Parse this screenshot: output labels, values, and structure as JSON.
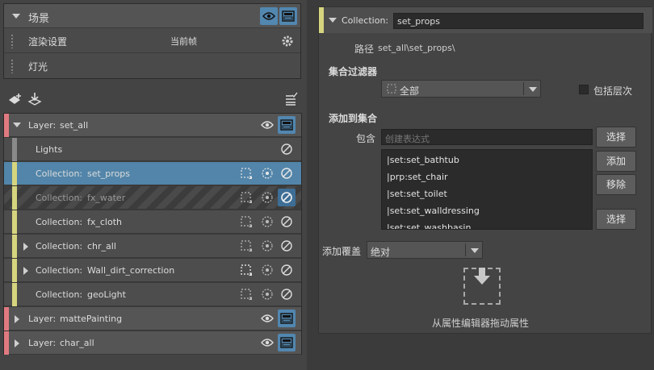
{
  "scene": {
    "title": "场景",
    "rows": [
      {
        "label": "渲染设置",
        "value": "当前帧"
      },
      {
        "label": "灯光"
      }
    ]
  },
  "list": [
    {
      "kind": "layer",
      "prefix": "Layer:",
      "name": "set_all",
      "expanded": true,
      "color": "#e07a80"
    },
    {
      "kind": "collection",
      "prefix": "",
      "name": "Lights",
      "color": "#8a8a8a",
      "state": "normal"
    },
    {
      "kind": "collection",
      "prefix": "Collection:",
      "name": "set_props",
      "color": "#d6d57f",
      "state": "selected"
    },
    {
      "kind": "collection",
      "prefix": "Collection:",
      "name": "fx_water",
      "color": "#d6d57f",
      "state": "disabled"
    },
    {
      "kind": "collection",
      "prefix": "Collection:",
      "name": "fx_cloth",
      "color": "#d6d57f",
      "state": "normal"
    },
    {
      "kind": "collection",
      "prefix": "Collection:",
      "name": "chr_all",
      "color": "#d6d57f",
      "state": "normal",
      "collapsed": true
    },
    {
      "kind": "collection",
      "prefix": "Collection:",
      "name": "Wall_dirt_correction",
      "color": "#d6d57f",
      "state": "normal",
      "collapsed": true
    },
    {
      "kind": "collection",
      "prefix": "Collection:",
      "name": "geoLight",
      "color": "#d6d57f",
      "state": "normal"
    },
    {
      "kind": "layer",
      "prefix": "Layer:",
      "name": "mattePainting",
      "color": "#e07a80"
    },
    {
      "kind": "layer",
      "prefix": "Layer:",
      "name": "char_all",
      "color": "#e07a80"
    }
  ],
  "attr": {
    "header_prefix": "Collection:",
    "name": "set_props",
    "path_label": "路径",
    "path_value": "set_all\\set_props\\",
    "filter_heading": "集合过滤器",
    "filter_value": "全部",
    "include_hierarchy": "包括层次",
    "add_heading": "添加到集合",
    "include_label": "包含",
    "include_placeholder": "创建表达式",
    "select_btn": "选择",
    "add_btn": "添加",
    "remove_btn": "移除",
    "select_btn2": "选择",
    "members": [
      "|set:set_bathtub",
      "|prp:set_chair",
      "|set:set_toilet",
      "|set:set_walldressing",
      "|set:set_washbasin"
    ],
    "override_label": "添加覆盖",
    "override_value": "绝对",
    "drop_hint": "从属性编辑器拖动属性"
  },
  "colors": {
    "accent": "#5287b0",
    "layer_stripe": "#e07a80",
    "collection_stripe": "#d6d57f"
  }
}
